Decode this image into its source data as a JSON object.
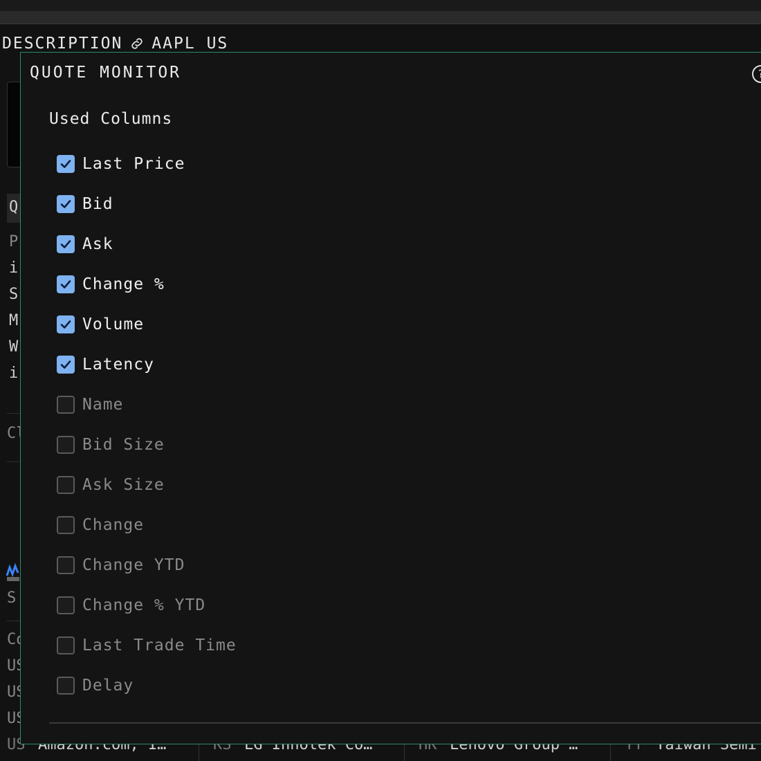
{
  "header": {
    "description_label": "DESCRIPTION",
    "ticker": "AAPL US"
  },
  "background": {
    "left_letters": [
      "Q",
      "P",
      "i",
      "S",
      "M",
      "W",
      "i",
      "Cl",
      "S",
      "Co",
      "US",
      "US",
      "US"
    ],
    "bottom_row": [
      {
        "exchange": "US",
        "name": "Amazon.com, I…"
      },
      {
        "exchange": "KS",
        "name": "LG Innotek Co…"
      },
      {
        "exchange": "HK",
        "name": "Lenovo Group …"
      },
      {
        "exchange": "TT",
        "name": "Taiwan Semi"
      }
    ]
  },
  "panel": {
    "title": "QUOTE MONITOR",
    "help_glyph": "?",
    "section_title": "Used Columns",
    "columns": [
      {
        "label": "Last Price",
        "checked": true
      },
      {
        "label": "Bid",
        "checked": true
      },
      {
        "label": "Ask",
        "checked": true
      },
      {
        "label": "Change %",
        "checked": true
      },
      {
        "label": "Volume",
        "checked": true
      },
      {
        "label": "Latency",
        "checked": true
      },
      {
        "label": "Name",
        "checked": false
      },
      {
        "label": "Bid Size",
        "checked": false
      },
      {
        "label": "Ask Size",
        "checked": false
      },
      {
        "label": "Change",
        "checked": false
      },
      {
        "label": "Change YTD",
        "checked": false
      },
      {
        "label": "Change % YTD",
        "checked": false
      },
      {
        "label": "Last Trade Time",
        "checked": false
      },
      {
        "label": "Delay",
        "checked": false
      }
    ]
  },
  "colors": {
    "accent_border": "#2f8a6e",
    "checkbox_on": "#7fb2f0"
  }
}
